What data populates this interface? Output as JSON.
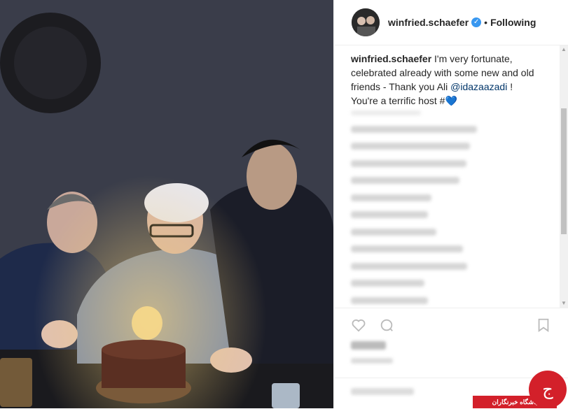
{
  "post": {
    "username": "winfried.schaefer",
    "verified_glyph": "✓",
    "separator": "•",
    "follow_status": "Following",
    "caption_user": "winfried.schaefer",
    "caption_text_1": "I'm very fortunate, celebrated already with some new and old friends - Thank you Ali ",
    "caption_mention": "@idazaazadi",
    "caption_text_2": " ! You're a terrific host #",
    "caption_emoji": "💙"
  },
  "icons": {
    "like": "heart-icon",
    "comment": "comment-icon",
    "save": "bookmark-icon"
  },
  "watermark": {
    "text": "باشگاه خبرنگاران",
    "logo_glyph": "ج"
  },
  "colors": {
    "verified": "#3897f0",
    "mention": "#003569",
    "watermark_red": "#d3202a"
  }
}
